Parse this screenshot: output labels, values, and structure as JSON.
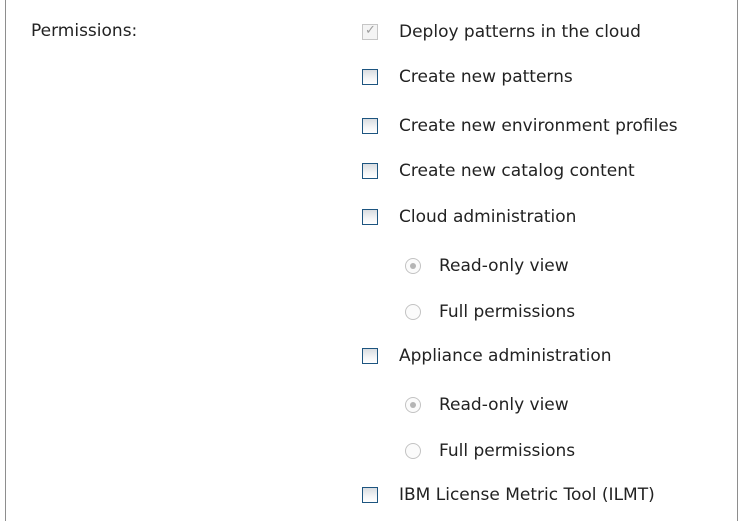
{
  "permissions_label": "Permissions:",
  "items": [
    {
      "label": "Deploy patterns in the cloud",
      "type": "checkbox",
      "checked": true,
      "disabled": true
    },
    {
      "label": "Create new patterns",
      "type": "checkbox",
      "checked": false,
      "disabled": false
    },
    {
      "label": "Create new environment profiles",
      "type": "checkbox",
      "checked": false,
      "disabled": false
    },
    {
      "label": "Create new catalog content",
      "type": "checkbox",
      "checked": false,
      "disabled": false
    },
    {
      "label": "Cloud administration",
      "type": "checkbox",
      "checked": false,
      "disabled": false
    },
    {
      "label": "Read-only view",
      "type": "radio",
      "selected": true,
      "disabled": true
    },
    {
      "label": "Full permissions",
      "type": "radio",
      "selected": false,
      "disabled": true
    },
    {
      "label": "Appliance administration",
      "type": "checkbox",
      "checked": false,
      "disabled": false
    },
    {
      "label": "Read-only view",
      "type": "radio",
      "selected": true,
      "disabled": true
    },
    {
      "label": "Full permissions",
      "type": "radio",
      "selected": false,
      "disabled": true
    },
    {
      "label": "IBM License Metric Tool (ILMT)",
      "type": "checkbox",
      "checked": false,
      "disabled": false
    }
  ]
}
